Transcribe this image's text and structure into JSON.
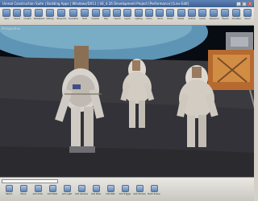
{
  "window": {
    "title": "Unreal Construction Suite | Building Apps | Windows/DX11 | UE_4.26 Development Project [Performance] [Live Edit]",
    "controls": [
      "_",
      "□",
      "×"
    ]
  },
  "toolbar": {
    "items": [
      {
        "label": "Save",
        "icon": "save-icon"
      },
      {
        "label": "Source",
        "icon": "source-icon"
      },
      {
        "label": "Content",
        "icon": "content-icon"
      },
      {
        "label": "Marketplace",
        "icon": "marketplace-icon"
      },
      {
        "label": "Settings",
        "icon": "settings-icon"
      },
      {
        "label": "Blueprints",
        "icon": "blueprints-icon"
      },
      {
        "label": "Cinematics",
        "icon": "cinematics-icon"
      },
      {
        "label": "Build",
        "icon": "build-icon"
      },
      {
        "label": "Compile",
        "icon": "compile-icon"
      },
      {
        "label": "Play",
        "icon": "play-icon"
      },
      {
        "label": "Launch",
        "icon": "launch-icon"
      },
      {
        "label": "Layers",
        "icon": "layers-icon"
      },
      {
        "label": "Lighting",
        "icon": "lighting-icon"
      },
      {
        "label": "Actors",
        "icon": "actors-icon"
      },
      {
        "label": "World",
        "icon": "world-icon"
      },
      {
        "label": "Modes",
        "icon": "modes-icon"
      },
      {
        "label": "Details",
        "icon": "details-icon"
      },
      {
        "label": "Outliner",
        "icon": "outliner-icon"
      },
      {
        "label": "Levels",
        "icon": "levels-icon"
      },
      {
        "label": "Sequencer",
        "icon": "sequencer-icon"
      },
      {
        "label": "Physics",
        "icon": "physics-icon"
      },
      {
        "label": "Animation",
        "icon": "animation-icon"
      },
      {
        "label": "Sound",
        "icon": "sound-icon"
      }
    ]
  },
  "viewport": {
    "label": "Perspective"
  },
  "bottom": {
    "tools": [
      {
        "label": "Select",
        "icon": "select-icon"
      },
      {
        "label": "Move",
        "icon": "move-icon"
      },
      {
        "label": "Add Actor",
        "icon": "add-actor-icon"
      },
      {
        "label": "Add Mesh",
        "icon": "add-mesh-icon"
      },
      {
        "label": "Add Light",
        "icon": "add-light-icon"
      },
      {
        "label": "Add Camera",
        "icon": "add-camera-icon"
      },
      {
        "label": "Add Note",
        "icon": "add-note-icon"
      },
      {
        "label": "Add Path",
        "icon": "add-path-icon"
      },
      {
        "label": "Add Trigger",
        "icon": "add-trigger-icon"
      },
      {
        "label": "Add Volume",
        "icon": "add-volume-icon"
      },
      {
        "label": "Build Scene",
        "icon": "build-scene-icon"
      }
    ]
  }
}
